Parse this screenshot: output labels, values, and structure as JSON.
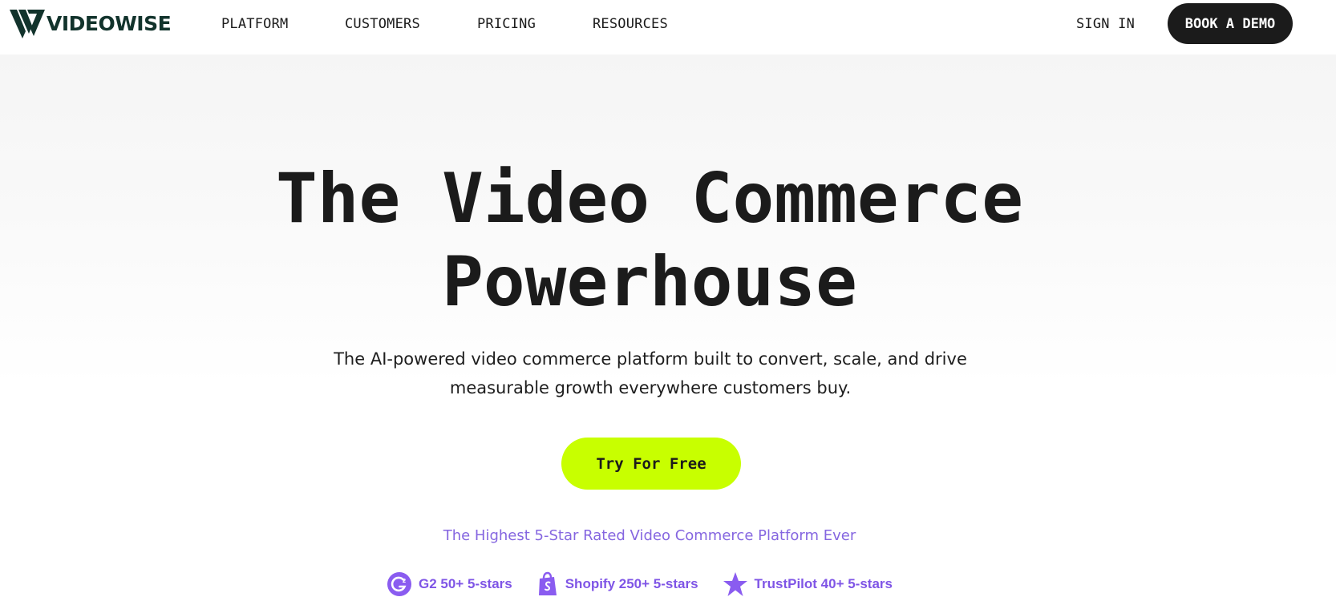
{
  "brand": {
    "name": "VIDEOWISE",
    "logo_icon": "videowise-v-logo-icon",
    "color": "#12332c"
  },
  "nav": {
    "items": [
      {
        "label": "PLATFORM"
      },
      {
        "label": "CUSTOMERS"
      },
      {
        "label": "PRICING"
      },
      {
        "label": "RESOURCES"
      }
    ],
    "sign_in_label": "SIGN IN",
    "demo_label": "BOOK A DEMO"
  },
  "hero": {
    "title_line1": "The Video Commerce",
    "title_line2": "Powerhouse",
    "subtitle_line1": "The AI-powered video commerce platform built to convert, scale, and drive",
    "subtitle_line2": "measurable growth everywhere customers buy.",
    "cta_label": "Try For Free",
    "cta_color": "#c8ff00",
    "rated_text": "The Highest 5-Star Rated Video Commerce Platform Ever",
    "accent_color": "#8566e0"
  },
  "ratings": [
    {
      "label": "G2 50+ 5-stars",
      "icon": "g2-icon"
    },
    {
      "label": "Shopify 250+ 5-stars",
      "icon": "shopify-bag-icon"
    },
    {
      "label": "TrustPilot 40+ 5-stars",
      "icon": "star-icon"
    }
  ]
}
